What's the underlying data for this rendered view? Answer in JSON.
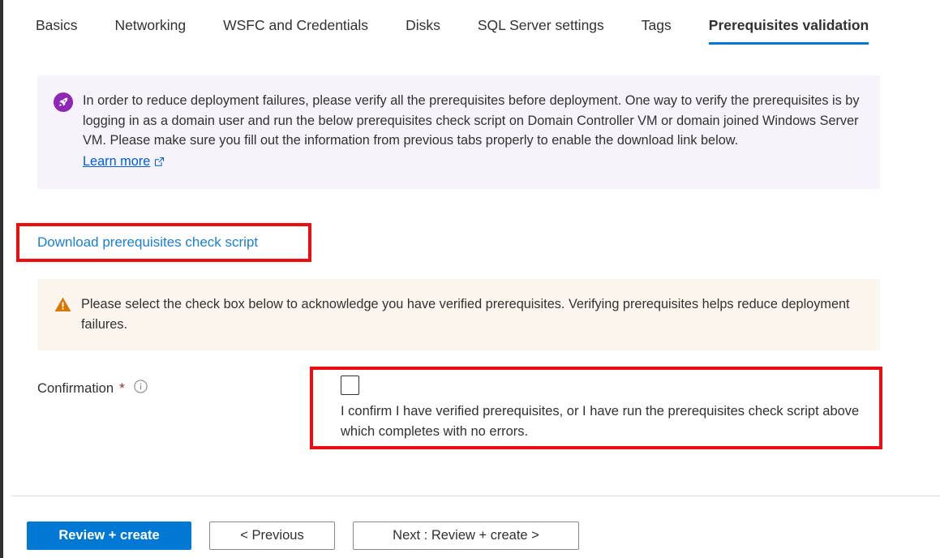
{
  "window": {
    "accent_blue": "#0078d4",
    "highlight_red": "#ec0d10"
  },
  "tabs": [
    {
      "label": "Basics",
      "active": false
    },
    {
      "label": "Networking",
      "active": false
    },
    {
      "label": "WSFC and Credentials",
      "active": false
    },
    {
      "label": "Disks",
      "active": false
    },
    {
      "label": "SQL Server settings",
      "active": false
    },
    {
      "label": "Tags",
      "active": false
    },
    {
      "label": "Prerequisites validation",
      "active": true
    }
  ],
  "info_banner": {
    "icon": "rocket-icon",
    "icon_color": "#9026b5",
    "background": "#f7f3fb",
    "text": "In order to reduce deployment failures, please verify all the prerequisites before deployment. One way to verify the prerequisites is by logging in as a domain user and run the below prerequisites check script on Domain Controller VM or domain joined Windows Server VM. Please make sure you fill out the information from previous tabs properly to enable the download link below.",
    "learn_more_label": "Learn more",
    "learn_more_icon": "external-link-icon"
  },
  "download": {
    "link_label": "Download prerequisites check script",
    "link_color": "#1a7fd4",
    "highlighted": true
  },
  "warning_banner": {
    "icon": "warning-triangle-icon",
    "icon_color": "#d97706",
    "background": "#fdf6ef",
    "text": "Please select the check box below to acknowledge you have verified prerequisites. Verifying prerequisites helps reduce deployment failures."
  },
  "confirmation": {
    "label": "Confirmation",
    "required_marker": "*",
    "info_icon": "info-circle-icon",
    "checkbox_checked": false,
    "checkbox_label": "I confirm I have verified prerequisites, or I have run the prerequisites check script above which completes with no errors.",
    "highlighted": true
  },
  "footer": {
    "review_create_label": "Review + create",
    "previous_label": "< Previous",
    "next_label": "Next : Review + create >"
  }
}
